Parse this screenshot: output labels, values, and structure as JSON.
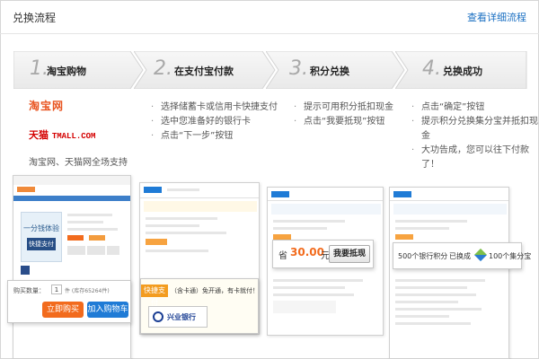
{
  "header": {
    "title": "兑换流程",
    "detail_link": "查看详细流程"
  },
  "steps": [
    {
      "number": "1.",
      "label": "淘宝购物"
    },
    {
      "number": "2.",
      "label": "在支付宝付款"
    },
    {
      "number": "3.",
      "label": "积分兑换"
    },
    {
      "number": "4.",
      "label": "兑换成功"
    }
  ],
  "brands": {
    "taobao": "淘宝网",
    "tmall_cn": "天猫",
    "tmall_en": "TMALL.COM",
    "caption": "淘宝网、天猫网全场支持"
  },
  "step2_bullets": [
    "选择储蓄卡或信用卡快捷支付",
    "选中您准备好的银行卡",
    "点击“下一步”按钮"
  ],
  "step3_bullets": [
    "提示可用积分抵扣现金",
    "点击“我要抵现”按钮"
  ],
  "step4_bullets": [
    "点击“确定”按钮",
    "提示积分兑换集分宝并抵扣现金",
    "大功告成，您可以往下付款了！"
  ],
  "shot1": {
    "qty_label": "购买数量：",
    "qty_value": "1",
    "stock": "件 (库存65264件)",
    "buy_now": "立即购买",
    "add_cart": "加入购物车",
    "banner_top": "一分钱体验",
    "banner_bottom": "快捷支付"
  },
  "shot2": {
    "quick_pay_tag": "快捷支付",
    "quick_pay_text": "（含卡通）免开通，有卡就付！",
    "bank_name": "兴业银行"
  },
  "shot3": {
    "currency": "省",
    "amount": "30.00",
    "unit": "元",
    "redeem_button": "我要抵现"
  },
  "shot4": {
    "points_text": "500个银行积分",
    "exchanged": "已换成",
    "jifenbao_text": "100个集分宝"
  },
  "colors": {
    "link": "#1a6fc2",
    "taobao": "#e8531f",
    "tmall": "#d40000",
    "buy_now": "#f26b1d",
    "add_cart": "#1f7bd6"
  }
}
